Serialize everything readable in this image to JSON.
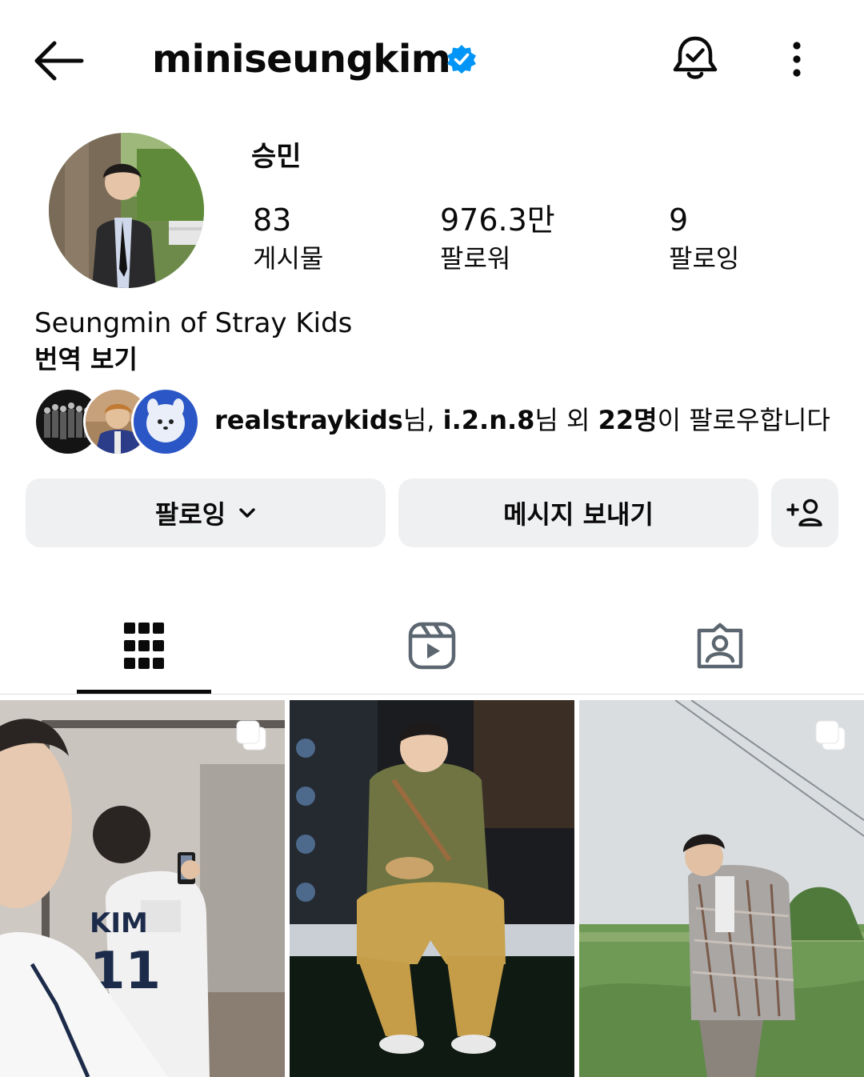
{
  "header": {
    "title": "miniseungkim",
    "verified": true
  },
  "profile": {
    "name": "승민",
    "stats": [
      {
        "value": "83",
        "label": "게시물"
      },
      {
        "value": "976.3만",
        "label": "팔로워"
      },
      {
        "value": "9",
        "label": "팔로잉"
      }
    ],
    "bio": "Seungmin of Stray Kids",
    "translate_label": "번역 보기"
  },
  "mutuals": {
    "user1": "realstraykids",
    "suffix1": "님, ",
    "user2": "i.2.n.8",
    "suffix2": "님 외 ",
    "count_text": "22명",
    "tail": "이 팔로우합니다"
  },
  "actions": {
    "follow_label": "팔로잉",
    "message_label": "메시지 보내기"
  },
  "tabs": [
    "grid",
    "reels",
    "tagged"
  ],
  "colors": {
    "verified": "#0095f6",
    "button_bg": "#eff0f2",
    "icon_gray": "#5b6670"
  },
  "icons": [
    "back-arrow-icon",
    "verified-badge-icon",
    "bell-check-icon",
    "more-vertical-icon",
    "chevron-down-icon",
    "add-person-icon",
    "grid-icon",
    "reels-icon",
    "tagged-icon",
    "multi-photo-icon"
  ]
}
